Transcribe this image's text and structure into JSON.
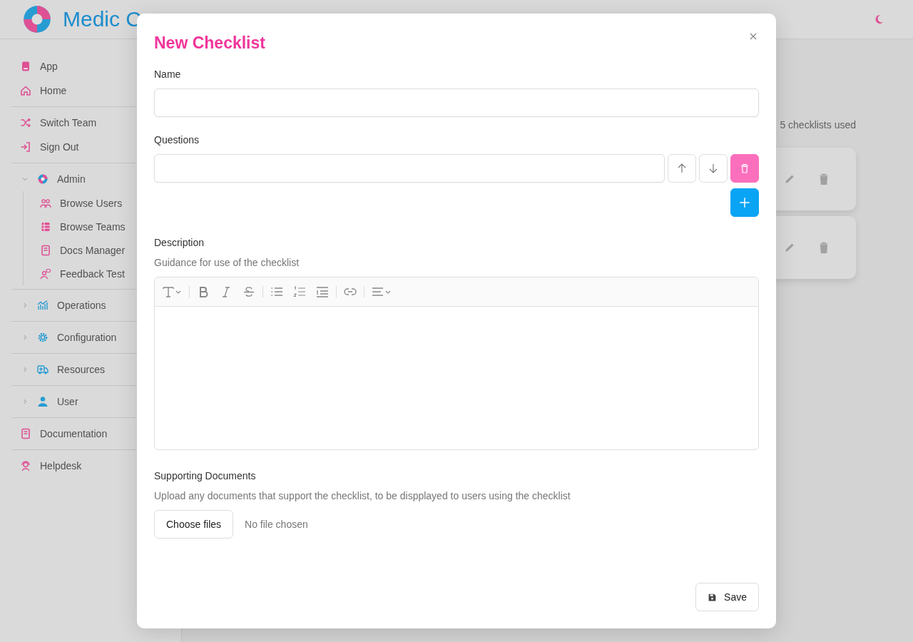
{
  "header": {
    "brand": "Medic C"
  },
  "sidebar": {
    "sections": [
      [
        {
          "label": "App"
        },
        {
          "label": "Home"
        }
      ],
      [
        {
          "label": "Switch Team"
        },
        {
          "label": "Sign Out"
        }
      ],
      [
        {
          "label": "Admin",
          "expanded": true,
          "children": [
            {
              "label": "Browse Users"
            },
            {
              "label": "Browse Teams"
            },
            {
              "label": "Docs Manager"
            },
            {
              "label": "Feedback Test"
            }
          ]
        }
      ],
      [
        {
          "label": "Operations",
          "expanded": false
        }
      ],
      [
        {
          "label": "Configuration",
          "expanded": false
        }
      ],
      [
        {
          "label": "Resources",
          "expanded": false
        }
      ],
      [
        {
          "label": "User",
          "expanded": false
        }
      ],
      [
        {
          "label": "Documentation"
        }
      ],
      [
        {
          "label": "Helpdesk"
        }
      ]
    ]
  },
  "background": {
    "usage": "5 checklists used"
  },
  "modal": {
    "title": "New Checklist",
    "name_label": "Name",
    "questions_label": "Questions",
    "description_label": "Description",
    "description_hint": "Guidance for use of the checklist",
    "documents_label": "Supporting Documents",
    "documents_hint": "Upload any documents that support the checklist, to be dispplayed to users using the checklist",
    "choose_button": "Choose files",
    "file_status": "No file chosen",
    "save_button": "Save"
  }
}
